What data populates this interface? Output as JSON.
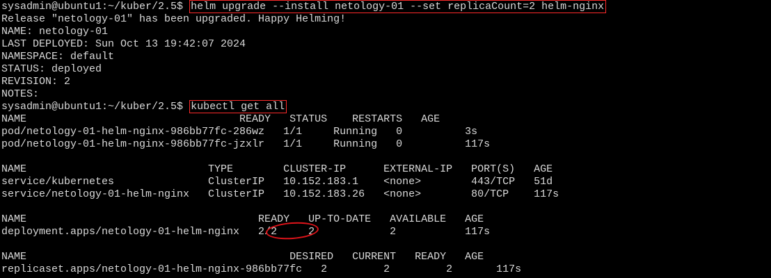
{
  "terminal": {
    "prompt": "sysadmin@ubuntu1:~/kuber/2.5$",
    "command1": "helm upgrade --install netology-01 --set replicaCount=2 helm-nginx",
    "helm_output": [
      "Release \"netology-01\" has been upgraded. Happy Helming!",
      "NAME: netology-01",
      "LAST DEPLOYED: Sun Oct 13 19:42:07 2024",
      "NAMESPACE: default",
      "STATUS: deployed",
      "REVISION: 2",
      "NOTES:"
    ],
    "command2": "kubectl get all",
    "pods": {
      "header": "NAME                                  READY   STATUS    RESTARTS   AGE",
      "rows": [
        "pod/netology-01-helm-nginx-986bb77fc-286wz   1/1     Running   0          3s",
        "pod/netology-01-helm-nginx-986bb77fc-jzxlr   1/1     Running   0          117s"
      ]
    },
    "services": {
      "header": "NAME                             TYPE        CLUSTER-IP      EXTERNAL-IP   PORT(S)   AGE",
      "rows": [
        "service/kubernetes               ClusterIP   10.152.183.1    <none>        443/TCP   51d",
        "service/netology-01-helm-nginx   ClusterIP   10.152.183.26   <none>        80/TCP    117s"
      ]
    },
    "deployments": {
      "header": "NAME                                     READY   UP-TO-DATE   AVAILABLE   AGE",
      "rows": [
        "deployment.apps/netology-01-helm-nginx   2/2     2            2           117s"
      ]
    },
    "replicasets": {
      "header": "NAME                                          DESIRED   CURRENT   READY   AGE",
      "rows": [
        "replicaset.apps/netology-01-helm-nginx-986bb77fc   2         2         2       117s"
      ]
    }
  },
  "colors": {
    "background": "#000000",
    "text": "#d9d9d9",
    "highlight_box": "#ff2b2b",
    "annotation_ellipse": "#e0141a"
  }
}
